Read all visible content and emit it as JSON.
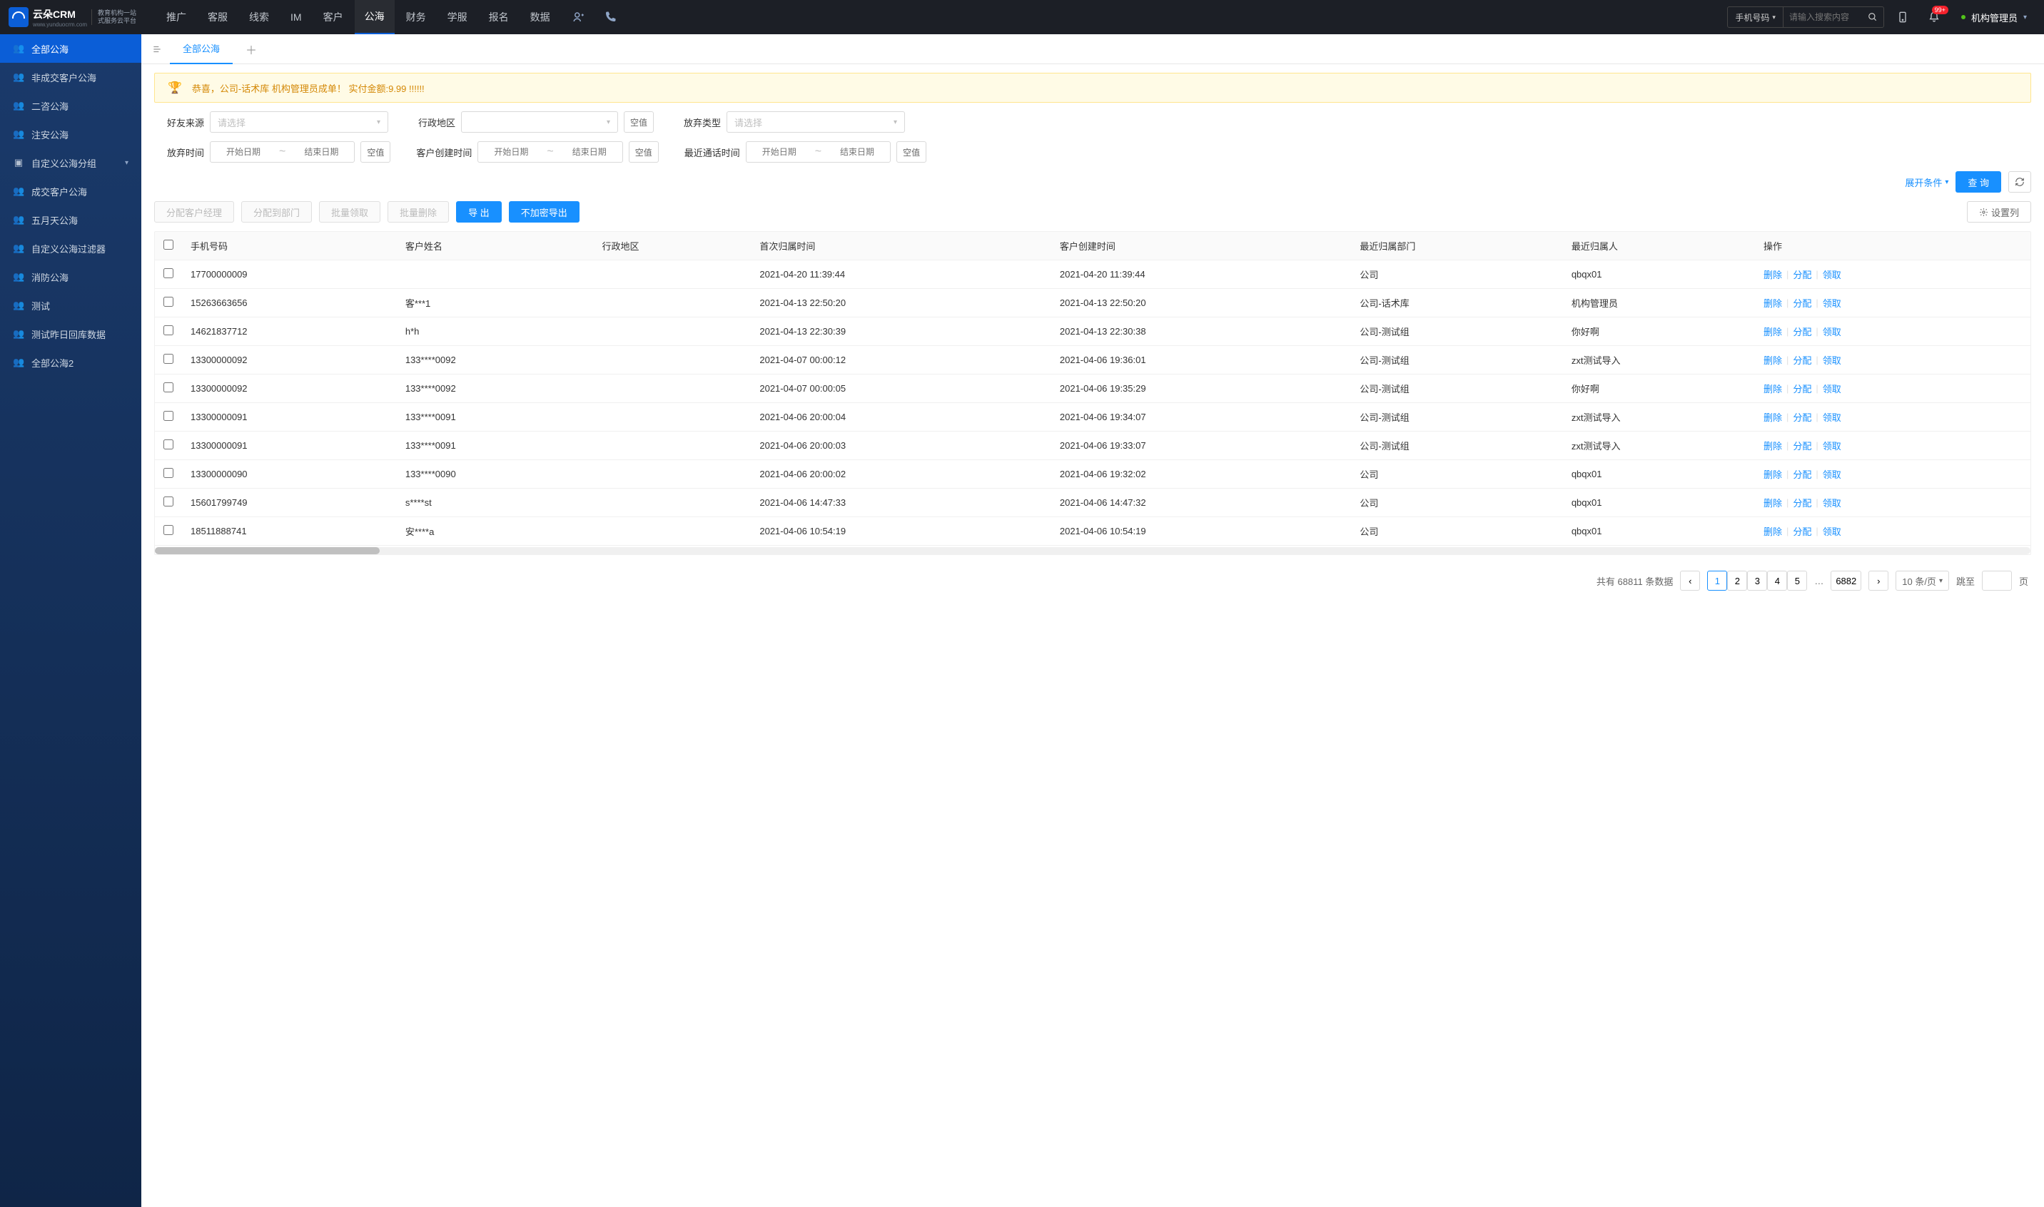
{
  "brand": {
    "name": "云朵CRM",
    "url": "www.yunduocrm.com",
    "sub1": "教育机构一站",
    "sub2": "式服务云平台"
  },
  "top_nav": [
    "推广",
    "客服",
    "线索",
    "IM",
    "客户",
    "公海",
    "财务",
    "学服",
    "报名",
    "数据"
  ],
  "top_nav_active": 5,
  "header": {
    "search_field": "手机号码",
    "search_placeholder": "请输入搜索内容",
    "badge": "99+",
    "user": "机构管理员"
  },
  "sidebar": [
    {
      "label": "全部公海",
      "icon": "👥",
      "active": true
    },
    {
      "label": "非成交客户公海",
      "icon": "👥"
    },
    {
      "label": "二咨公海",
      "icon": "👥"
    },
    {
      "label": "注安公海",
      "icon": "👥"
    },
    {
      "label": "自定义公海分组",
      "icon": "▣",
      "expandable": true
    },
    {
      "label": "成交客户公海",
      "icon": "👥"
    },
    {
      "label": "五月天公海",
      "icon": "👥"
    },
    {
      "label": "自定义公海过滤器",
      "icon": "👥"
    },
    {
      "label": "消防公海",
      "icon": "👥"
    },
    {
      "label": "测试",
      "icon": "👥"
    },
    {
      "label": "测试昨日回库数据",
      "icon": "👥"
    },
    {
      "label": "全部公海2",
      "icon": "👥"
    }
  ],
  "tabs": {
    "active": "全部公海"
  },
  "banner": "恭喜，公司-话术库  机构管理员成单！  实付金额:9.99 !!!!!!",
  "filters": {
    "friend_source": {
      "label": "好友来源",
      "placeholder": "请选择"
    },
    "region": {
      "label": "行政地区",
      "placeholder": "",
      "empty_btn": "空值"
    },
    "abandon_type": {
      "label": "放弃类型",
      "placeholder": "请选择"
    },
    "abandon_time": {
      "label": "放弃时间",
      "start": "开始日期",
      "end": "结束日期",
      "empty_btn": "空值"
    },
    "create_time": {
      "label": "客户创建时间",
      "start": "开始日期",
      "end": "结束日期",
      "empty_btn": "空值"
    },
    "last_call": {
      "label": "最近通话时间",
      "start": "开始日期",
      "end": "结束日期",
      "empty_btn": "空值"
    },
    "expand": "展开条件",
    "query": "查 询"
  },
  "actions": {
    "assign_manager": "分配客户经理",
    "assign_dept": "分配到部门",
    "batch_claim": "批量领取",
    "batch_delete": "批量删除",
    "export": "导 出",
    "export_plain": "不加密导出",
    "set_cols": "设置列"
  },
  "table": {
    "headers": [
      "手机号码",
      "客户姓名",
      "行政地区",
      "首次归属时间",
      "客户创建时间",
      "最近归属部门",
      "最近归属人",
      "操作"
    ],
    "ops": {
      "del": "删除",
      "assign": "分配",
      "claim": "领取"
    },
    "rows": [
      {
        "phone": "17700000009",
        "name": "",
        "first_time": "2021-04-20 11:39:44",
        "create_time": "2021-04-20 11:39:44",
        "dept": "公司",
        "owner": "qbqx01"
      },
      {
        "phone": "15263663656",
        "name": "客***1",
        "first_time": "2021-04-13 22:50:20",
        "create_time": "2021-04-13 22:50:20",
        "dept": "公司-话术库",
        "owner": "机构管理员"
      },
      {
        "phone": "14621837712",
        "name": "h*h",
        "first_time": "2021-04-13 22:30:39",
        "create_time": "2021-04-13 22:30:38",
        "dept": "公司-测试组",
        "owner": "你好啊"
      },
      {
        "phone": "13300000092",
        "name": "133****0092",
        "first_time": "2021-04-07 00:00:12",
        "create_time": "2021-04-06 19:36:01",
        "dept": "公司-测试组",
        "owner": "zxt测试导入"
      },
      {
        "phone": "13300000092",
        "name": "133****0092",
        "first_time": "2021-04-07 00:00:05",
        "create_time": "2021-04-06 19:35:29",
        "dept": "公司-测试组",
        "owner": "你好啊"
      },
      {
        "phone": "13300000091",
        "name": "133****0091",
        "first_time": "2021-04-06 20:00:04",
        "create_time": "2021-04-06 19:34:07",
        "dept": "公司-测试组",
        "owner": "zxt测试导入"
      },
      {
        "phone": "13300000091",
        "name": "133****0091",
        "first_time": "2021-04-06 20:00:03",
        "create_time": "2021-04-06 19:33:07",
        "dept": "公司-测试组",
        "owner": "zxt测试导入"
      },
      {
        "phone": "13300000090",
        "name": "133****0090",
        "first_time": "2021-04-06 20:00:02",
        "create_time": "2021-04-06 19:32:02",
        "dept": "公司",
        "owner": "qbqx01"
      },
      {
        "phone": "15601799749",
        "name": "s****st",
        "first_time": "2021-04-06 14:47:33",
        "create_time": "2021-04-06 14:47:32",
        "dept": "公司",
        "owner": "qbqx01"
      },
      {
        "phone": "18511888741",
        "name": "安****a",
        "first_time": "2021-04-06 10:54:19",
        "create_time": "2021-04-06 10:54:19",
        "dept": "公司",
        "owner": "qbqx01"
      }
    ]
  },
  "pagination": {
    "total_text": "共有",
    "count": "68811",
    "unit": "条数据",
    "pages": [
      "1",
      "2",
      "3",
      "4",
      "5"
    ],
    "ellipsis": "…",
    "last": "6882",
    "size": "10 条/页",
    "jump": "跳至",
    "page_suffix": "页"
  }
}
